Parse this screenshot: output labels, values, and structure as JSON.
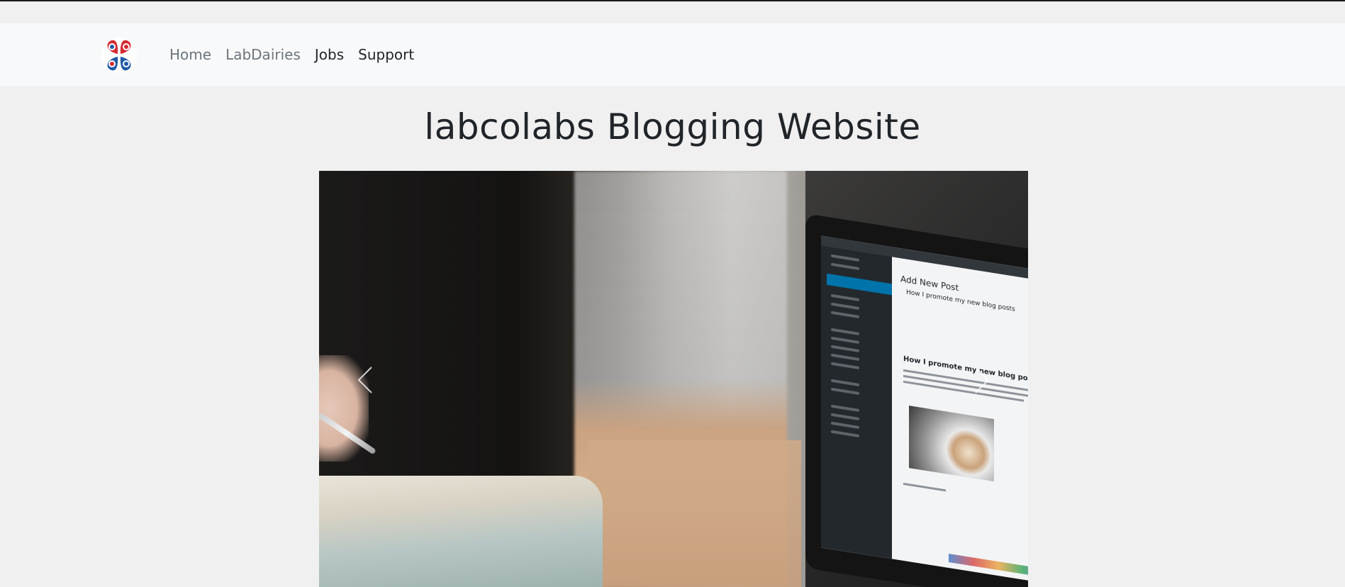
{
  "navbar": {
    "brand": {
      "icon": "labcolabs-logo-icon",
      "colors": [
        "#d42a32",
        "#1f5aa6"
      ]
    },
    "links": [
      {
        "label": "Home",
        "tone": "muted"
      },
      {
        "label": "LabDairies",
        "tone": "muted"
      },
      {
        "label": "Jobs",
        "tone": "strong"
      },
      {
        "label": "Support",
        "tone": "strong"
      }
    ]
  },
  "page": {
    "title": "labcolabs Blogging Website"
  },
  "carousel": {
    "prev_icon": "chevron-left-icon",
    "next_icon": "chevron-right-icon",
    "slides": [
      {
        "image": "notebook-and-coffee-photo"
      },
      {
        "image": "laptop-wordpress-editor-photo",
        "screen_heading": "Add New Post",
        "screen_post_title": "How I promote my new blog posts",
        "screen_body_heading": "How I promote my new blog posts"
      }
    ]
  },
  "colors": {
    "page_bg": "#f0f0f0",
    "navbar_bg": "#f8f9fa",
    "muted_link": "#6c757d",
    "strong_link": "#212529"
  }
}
